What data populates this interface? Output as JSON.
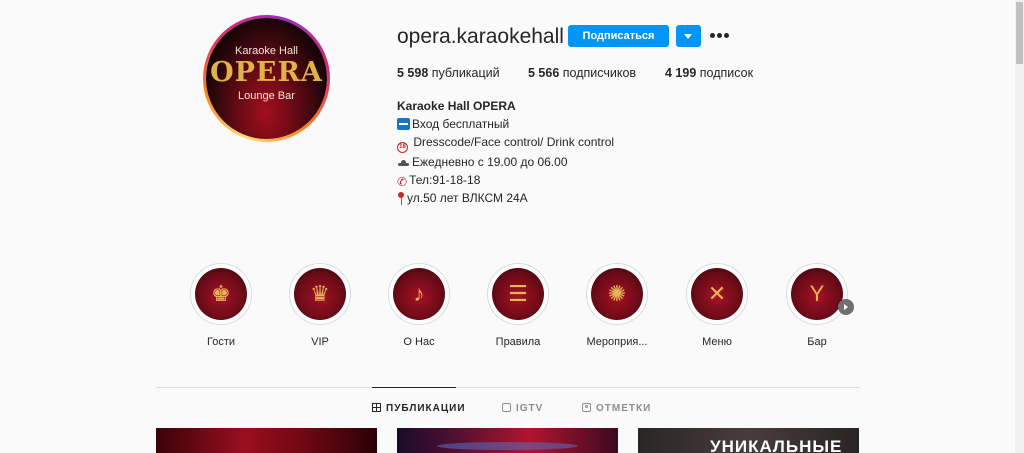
{
  "profile": {
    "avatar": {
      "top_text": "Karaoke Hall",
      "big_text": "OPERA",
      "bottom_text": "Lounge Bar"
    },
    "username": "opera.karaokehall",
    "follow_label": "Подписаться",
    "stats": [
      {
        "count": "5 598",
        "label": "публикаций"
      },
      {
        "count": "5 566",
        "label": "подписчиков"
      },
      {
        "count": "4 199",
        "label": "подписок"
      }
    ],
    "bio": {
      "name": "Karaoke Hall OPERA",
      "lines": [
        {
          "icon": "free-icon",
          "text": "Вход бесплатный"
        },
        {
          "icon": "eighteen-plus-icon",
          "text": " Dresscode/Face control/ Drink control"
        },
        {
          "icon": "hat-icon",
          "text": "Ежедневно с 19.00 до 06.00"
        },
        {
          "icon": "phone-icon",
          "text": "Тел:91-18-18"
        },
        {
          "icon": "pin-icon",
          "text": "ул.50 лет ВЛКСМ 24А"
        }
      ]
    }
  },
  "highlights": [
    {
      "label": "Гости",
      "icon": "guest-icon",
      "glyph": "♚"
    },
    {
      "label": "VIP",
      "icon": "crown-icon",
      "glyph": "♛"
    },
    {
      "label": "О Нас",
      "icon": "microphone-icon",
      "glyph": "♪"
    },
    {
      "label": "Правила",
      "icon": "rules-icon",
      "glyph": "☰"
    },
    {
      "label": "Мероприя...",
      "icon": "disco-ball-icon",
      "glyph": "✺"
    },
    {
      "label": "Меню",
      "icon": "menu-book-icon",
      "glyph": "✕"
    },
    {
      "label": "Бар",
      "icon": "cocktail-icon",
      "glyph": "Y"
    }
  ],
  "tabs": [
    {
      "label": "ПУБЛИКАЦИИ",
      "icon": "grid-icon",
      "active": true
    },
    {
      "label": "IGTV",
      "icon": "tv-icon",
      "active": false
    },
    {
      "label": "ОТМЕТКИ",
      "icon": "tag-icon",
      "active": false
    }
  ],
  "posts": [
    {
      "text": ""
    },
    {
      "text": ""
    },
    {
      "text": "УНИКАЛЬНЫЕ"
    }
  ],
  "colors": {
    "accent": "#0095f6",
    "brand_red": "#a30f1e",
    "brand_gold": "#e2b24a"
  }
}
